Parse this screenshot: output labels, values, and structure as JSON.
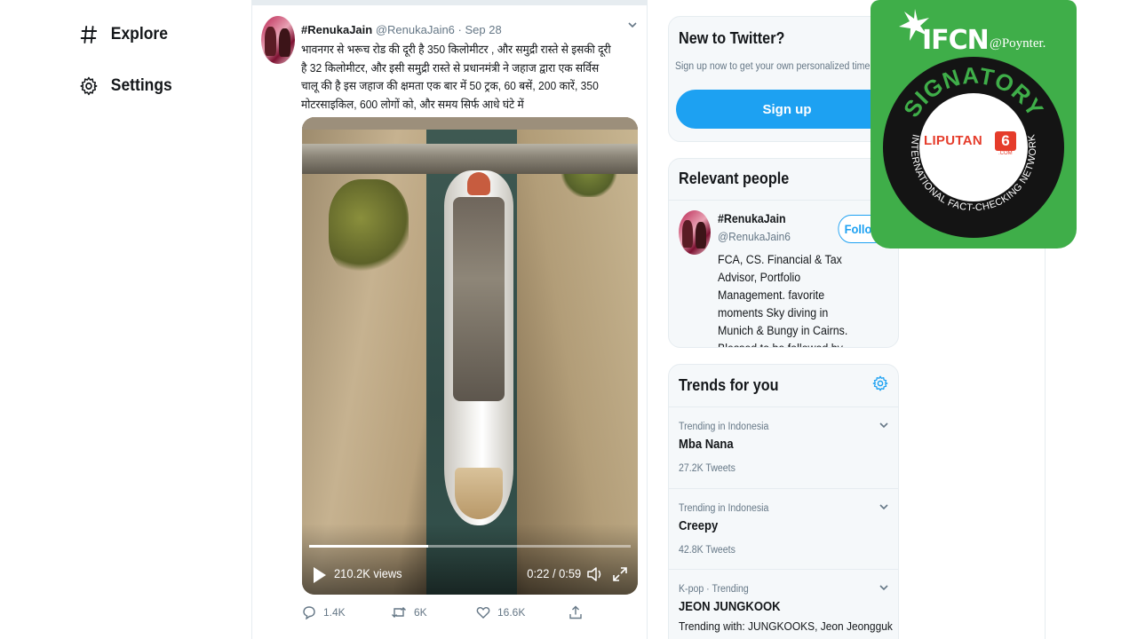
{
  "nav": {
    "explore_label": "Explore",
    "settings_label": "Settings"
  },
  "tweet": {
    "name": "#RenukaJain",
    "handle": "@RenukaJain6",
    "separator": "·",
    "date": "Sep 28",
    "text": "भावनगर से भरूच रोड की दूरी है 350 किलोमीटर , और समुद्री रास्ते से इसकी दूरी है 32 किलोमीटर, और इसी समुद्री रास्ते से प्रधानमंत्री ने जहाज द्वारा एक सर्विस चालू की है इस जहाज की क्षमता एक बार में 50 ट्रक, 60 बसें, 200 कारें, 350 मोटरसाइकिल, 600 लोगों को, और समय सिर्फ आधे घंटे में",
    "video": {
      "views": "210.2K views",
      "time": "0:22 / 0:59",
      "progress_fraction": 0.37
    },
    "actions": {
      "replies": "1.4K",
      "retweets": "6K",
      "likes": "16.6K"
    }
  },
  "signup_card": {
    "title": "New to Twitter?",
    "subtitle": "Sign up now to get your own personalized timeline!",
    "button_label": "Sign up"
  },
  "relevant_people": {
    "title": "Relevant people",
    "name": "#RenukaJain",
    "handle": "@RenukaJain6",
    "follow_label": "Follow",
    "bio": "FCA, CS. Financial & Tax Advisor, Portfolio Management. favorite moments Sky diving in Munich & Bungy in Cairns. Blessed to be followed by respected PM 🙏"
  },
  "trends": {
    "title": "Trends for you",
    "items": [
      {
        "context": "Trending in Indonesia",
        "name": "Mba Nana",
        "count": "27.2K Tweets"
      },
      {
        "context": "Trending in Indonesia",
        "name": "Creepy",
        "count": "42.8K Tweets"
      },
      {
        "context": "K-pop · Trending",
        "name": "JEON JUNGKOOK",
        "count": "Trending with: JUNGKOOKS, Jeon Jeongguk"
      }
    ]
  },
  "badge": {
    "ifcn": "IFCN",
    "poynter": "@Poynter.",
    "signatory": "SIGNATORY",
    "network": "INTERNATIONAL FACT-CHECKING NETWORK",
    "liputan_word": "LIPUTAN",
    "liputan_six": "6",
    "liputan_com": ".COM"
  },
  "colors": {
    "twitter_blue": "#1da1f2",
    "muted_text": "#657786",
    "badge_green": "#3fae49",
    "liputan_red": "#e53c2b"
  }
}
